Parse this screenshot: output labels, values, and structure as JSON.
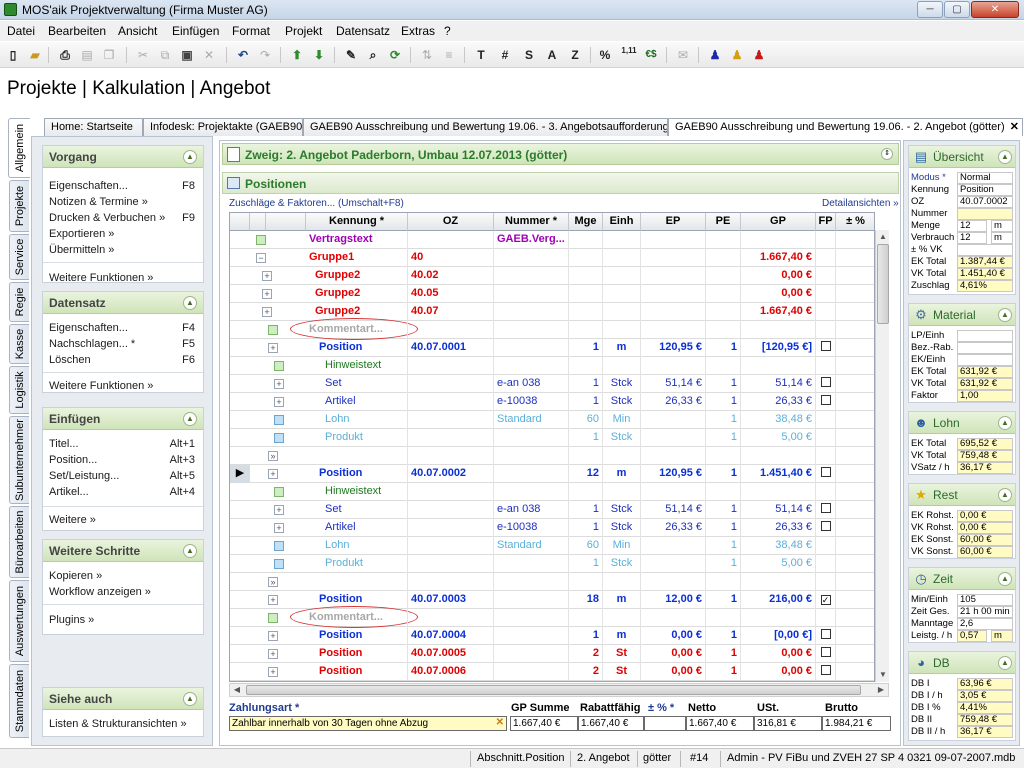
{
  "window": {
    "title": "MOS'aik Projektverwaltung (Firma Muster AG)",
    "min": "─",
    "max": "▢",
    "close": "✕"
  },
  "menu": [
    "Datei",
    "Bearbeiten",
    "Ansicht",
    "Einfügen",
    "Format",
    "Projekt",
    "Datensatz",
    "Extras",
    "?"
  ],
  "toolbar": {
    "text_buttons": [
      "T",
      "#",
      "S",
      "A",
      "Z",
      "%",
      "1,11",
      "€$"
    ]
  },
  "heading": "Projekte | Kalkulation | Angebot",
  "vtabs": [
    "Allgemein",
    "Projekte",
    "Service",
    "Regie",
    "Kasse",
    "Logistik",
    "Subunternehmer",
    "Büroarbeiten",
    "Auswertungen",
    "Stammdaten"
  ],
  "tabs": [
    "Home: Startseite",
    "Infodesk: Projektakte (GAEB90",
    "GAEB90 Ausschreibung und Bewertung 19.06. - 3. Angebotsaufforderung",
    "GAEB90 Ausschreibung und Bewertung 19.06. - 2. Angebot (götter)"
  ],
  "left": {
    "vorgang": {
      "title": "Vorgang",
      "items": [
        {
          "label": "Eigenschaften...",
          "key": "F8"
        },
        {
          "label": "Notizen & Termine »",
          "key": ""
        },
        {
          "label": "Drucken & Verbuchen »",
          "key": "F9"
        },
        {
          "label": "Exportieren »",
          "key": ""
        },
        {
          "label": "Übermitteln »",
          "key": ""
        }
      ],
      "more": "Weitere Funktionen »"
    },
    "datensatz": {
      "title": "Datensatz",
      "items": [
        {
          "label": "Eigenschaften...",
          "key": "F4"
        },
        {
          "label": "Nachschlagen... *",
          "key": "F5"
        },
        {
          "label": "Löschen",
          "key": "F6"
        }
      ],
      "more": "Weitere Funktionen »"
    },
    "einfuegen": {
      "title": "Einfügen",
      "items": [
        {
          "label": "Titel...",
          "key": "Alt+1"
        },
        {
          "label": "Position...",
          "key": "Alt+3"
        },
        {
          "label": "Set/Leistung...",
          "key": "Alt+5"
        },
        {
          "label": "Artikel...",
          "key": "Alt+4"
        }
      ],
      "more": "Weitere »"
    },
    "schritte": {
      "title": "Weitere Schritte",
      "items": [
        "Kopieren »",
        "Workflow anzeigen »"
      ],
      "more": "Plugins »"
    },
    "siehe": {
      "title": "Siehe auch",
      "items": [
        "Listen & Strukturansichten »"
      ]
    }
  },
  "main": {
    "zweig": "Zweig: 2. Angebot Paderborn, Umbau 12.07.2013 (götter)",
    "positionen": "Positionen",
    "zuschlaege": "Zuschläge & Faktoren... (Umschalt+F8)",
    "details": "Detailansichten »",
    "columns": [
      "Kennung *",
      "OZ",
      "Nummer *",
      "Mge",
      "Einh",
      "EP",
      "PE",
      "GP",
      "FP",
      "± %"
    ],
    "rows": [
      {
        "k": "Vertragstext",
        "oz": "",
        "nr": "GAEB.Verg...",
        "mge": "",
        "einh": "",
        "ep": "",
        "pe": "",
        "gp": "",
        "fp": "",
        "cls": "purple",
        "node": "g",
        "lvl": 0,
        "exp": false
      },
      {
        "k": "Gruppe1",
        "oz": "40",
        "nr": "",
        "mge": "",
        "einh": "",
        "ep": "",
        "pe": "",
        "gp": "1.667,40 €",
        "fp": "",
        "cls": "red",
        "node": "",
        "lvl": 0,
        "exp": true
      },
      {
        "k": "Gruppe2",
        "oz": "40.02",
        "nr": "",
        "mge": "",
        "einh": "",
        "ep": "",
        "pe": "",
        "gp": "0,00 €",
        "fp": "",
        "cls": "red",
        "node": "",
        "lvl": 1,
        "exp": true
      },
      {
        "k": "Gruppe2",
        "oz": "40.05",
        "nr": "",
        "mge": "",
        "einh": "",
        "ep": "",
        "pe": "",
        "gp": "0,00 €",
        "fp": "",
        "cls": "red",
        "node": "",
        "lvl": 1,
        "exp": true
      },
      {
        "k": "Gruppe2",
        "oz": "40.07",
        "nr": "",
        "mge": "",
        "einh": "",
        "ep": "",
        "pe": "",
        "gp": "1.667,40 €",
        "fp": "",
        "cls": "red",
        "node": "",
        "lvl": 1,
        "exp": true
      },
      {
        "k": "Kommentart...",
        "oz": "",
        "nr": "",
        "mge": "",
        "einh": "",
        "ep": "",
        "pe": "",
        "gp": "",
        "fp": "",
        "cls": "gray",
        "node": "g",
        "lvl": 2,
        "exp": false,
        "oval": true
      },
      {
        "k": "Position",
        "oz": "40.07.0001",
        "nr": "",
        "mge": "1",
        "einh": "m",
        "ep": "120,95 €",
        "pe": "1",
        "gp": "[120,95 €]",
        "fp": "□",
        "cls": "blue",
        "node": "",
        "lvl": 2,
        "exp": true
      },
      {
        "k": "Hinweistext",
        "oz": "",
        "nr": "",
        "mge": "",
        "einh": "",
        "ep": "",
        "pe": "",
        "gp": "",
        "fp": "",
        "cls": "green",
        "node": "g",
        "lvl": 3,
        "exp": false
      },
      {
        "k": "Set",
        "oz": "",
        "nr": "e-an 038",
        "mge": "1",
        "einh": "Stck",
        "ep": "51,14 €",
        "pe": "1",
        "gp": "51,14 €",
        "fp": "□",
        "cls": "lblue",
        "node": "",
        "lvl": 3,
        "exp": true
      },
      {
        "k": "Artikel",
        "oz": "",
        "nr": "e-10038",
        "mge": "1",
        "einh": "Stck",
        "ep": "26,33 €",
        "pe": "1",
        "gp": "26,33 €",
        "fp": "□",
        "cls": "lblue",
        "node": "",
        "lvl": 3,
        "exp": true
      },
      {
        "k": "Lohn",
        "oz": "",
        "nr": "Standard",
        "mge": "60",
        "einh": "Min",
        "ep": "",
        "pe": "1",
        "gp": "38,48 €",
        "fp": "",
        "cls": "cyan",
        "node": "b",
        "lvl": 3,
        "exp": false
      },
      {
        "k": "Produkt",
        "oz": "",
        "nr": "",
        "mge": "1",
        "einh": "Stck",
        "ep": "",
        "pe": "1",
        "gp": "5,00 €",
        "fp": "",
        "cls": "cyan",
        "node": "b",
        "lvl": 3,
        "exp": false
      },
      {
        "k": "",
        "oz": "",
        "nr": "",
        "mge": "",
        "einh": "",
        "ep": "",
        "pe": "",
        "gp": "",
        "fp": "",
        "cls": "",
        "node": "",
        "lvl": 2,
        "exp": false,
        "more": true
      },
      {
        "k": "Position",
        "oz": "40.07.0002",
        "nr": "",
        "mge": "12",
        "einh": "m",
        "ep": "120,95 €",
        "pe": "1",
        "gp": "1.451,40 €",
        "fp": "□",
        "cls": "blue",
        "node": "",
        "lvl": 2,
        "exp": true,
        "current": true
      },
      {
        "k": "Hinweistext",
        "oz": "",
        "nr": "",
        "mge": "",
        "einh": "",
        "ep": "",
        "pe": "",
        "gp": "",
        "fp": "",
        "cls": "green",
        "node": "g",
        "lvl": 3,
        "exp": false
      },
      {
        "k": "Set",
        "oz": "",
        "nr": "e-an 038",
        "mge": "1",
        "einh": "Stck",
        "ep": "51,14 €",
        "pe": "1",
        "gp": "51,14 €",
        "fp": "□",
        "cls": "lblue",
        "node": "",
        "lvl": 3,
        "exp": true
      },
      {
        "k": "Artikel",
        "oz": "",
        "nr": "e-10038",
        "mge": "1",
        "einh": "Stck",
        "ep": "26,33 €",
        "pe": "1",
        "gp": "26,33 €",
        "fp": "□",
        "cls": "lblue",
        "node": "",
        "lvl": 3,
        "exp": true
      },
      {
        "k": "Lohn",
        "oz": "",
        "nr": "Standard",
        "mge": "60",
        "einh": "Min",
        "ep": "",
        "pe": "1",
        "gp": "38,48 €",
        "fp": "",
        "cls": "cyan",
        "node": "b",
        "lvl": 3,
        "exp": false
      },
      {
        "k": "Produkt",
        "oz": "",
        "nr": "",
        "mge": "1",
        "einh": "Stck",
        "ep": "",
        "pe": "1",
        "gp": "5,00 €",
        "fp": "",
        "cls": "cyan",
        "node": "b",
        "lvl": 3,
        "exp": false
      },
      {
        "k": "",
        "oz": "",
        "nr": "",
        "mge": "",
        "einh": "",
        "ep": "",
        "pe": "",
        "gp": "",
        "fp": "",
        "cls": "",
        "node": "",
        "lvl": 2,
        "exp": false,
        "more": true
      },
      {
        "k": "Position",
        "oz": "40.07.0003",
        "nr": "",
        "mge": "18",
        "einh": "m",
        "ep": "12,00 €",
        "pe": "1",
        "gp": "216,00 €",
        "fp": "☑",
        "cls": "blue",
        "node": "",
        "lvl": 2,
        "exp": true
      },
      {
        "k": "Kommentart...",
        "oz": "",
        "nr": "",
        "mge": "",
        "einh": "",
        "ep": "",
        "pe": "",
        "gp": "",
        "fp": "",
        "cls": "gray",
        "node": "g",
        "lvl": 2,
        "exp": false,
        "oval": true
      },
      {
        "k": "Position",
        "oz": "40.07.0004",
        "nr": "",
        "mge": "1",
        "einh": "m",
        "ep": "0,00 €",
        "pe": "1",
        "gp": "[0,00 €]",
        "fp": "□",
        "cls": "blue",
        "node": "",
        "lvl": 2,
        "exp": true
      },
      {
        "k": "Position",
        "oz": "40.07.0005",
        "nr": "",
        "mge": "2",
        "einh": "St",
        "ep": "0,00 €",
        "pe": "1",
        "gp": "0,00 €",
        "fp": "□",
        "cls": "red",
        "node": "",
        "lvl": 2,
        "exp": true
      },
      {
        "k": "Position",
        "oz": "40.07.0006",
        "nr": "",
        "mge": "2",
        "einh": "St",
        "ep": "0,00 €",
        "pe": "1",
        "gp": "0,00 €",
        "fp": "□",
        "cls": "red",
        "node": "",
        "lvl": 2,
        "exp": true
      }
    ]
  },
  "footer": {
    "zahlungsart_label": "Zahlungsart *",
    "zahlungsart": "Zahlbar innerhalb von 30 Tagen ohne Abzug",
    "gp_summe_label": "GP Summe",
    "gp_summe": "1.667,40 €",
    "rabattfaehig_label": "Rabattfähig",
    "rabattfaehig": "1.667,40 €",
    "pm_label": "± % *",
    "pm": "",
    "netto_label": "Netto",
    "netto": "1.667,40 €",
    "ust_label": "USt.",
    "ust": "316,81 €",
    "brutto_label": "Brutto",
    "brutto": "1.984,21 €"
  },
  "right": {
    "uebersicht": {
      "title": "Übersicht",
      "rows": [
        [
          "Modus *",
          "Normal",
          ""
        ],
        [
          "Kennung",
          "Position",
          ""
        ],
        [
          "OZ",
          "40.07.0002",
          ""
        ],
        [
          "Nummer",
          "",
          "y"
        ],
        [
          "Menge",
          "12",
          "",
          "m"
        ],
        [
          "Verbrauch",
          "12",
          "",
          "m"
        ],
        [
          "± % VK",
          "",
          ""
        ],
        [
          "EK Total",
          "1.387,44 €",
          "y"
        ],
        [
          "VK Total",
          "1.451,40 €",
          "y"
        ],
        [
          "Zuschlag",
          "4,61%",
          "y"
        ]
      ]
    },
    "material": {
      "title": "Material",
      "rows": [
        [
          "LP/Einh",
          "",
          ""
        ],
        [
          "Bez.-Rab.",
          "",
          ""
        ],
        [
          "EK/Einh",
          "",
          ""
        ],
        [
          "EK Total",
          "631,92 €",
          "y"
        ],
        [
          "VK Total",
          "631,92 €",
          "y"
        ],
        [
          "Faktor",
          "1,00",
          "y"
        ]
      ]
    },
    "lohn": {
      "title": "Lohn",
      "rows": [
        [
          "EK Total",
          "695,52 €",
          "y"
        ],
        [
          "VK Total",
          "759,48 €",
          "y"
        ],
        [
          "VSatz / h",
          "36,17 €",
          "y"
        ]
      ]
    },
    "rest": {
      "title": "Rest",
      "rows": [
        [
          "EK Rohst.",
          "0,00 €",
          "y"
        ],
        [
          "VK Rohst.",
          "0,00 €",
          "y"
        ],
        [
          "EK Sonst.",
          "60,00 €",
          "y"
        ],
        [
          "VK Sonst.",
          "60,00 €",
          "y"
        ]
      ]
    },
    "zeit": {
      "title": "Zeit",
      "rows": [
        [
          "Min/Einh",
          "105",
          ""
        ],
        [
          "Zeit Ges.",
          "21 h 00 min",
          ""
        ],
        [
          "Manntage",
          "2,6",
          ""
        ],
        [
          "Leistg. / h",
          "0,57",
          "y",
          "m"
        ]
      ]
    },
    "db": {
      "title": "DB",
      "rows": [
        [
          "DB I",
          "63,96 €",
          "y"
        ],
        [
          "DB I / h",
          "3,05 €",
          "y"
        ],
        [
          "DB I %",
          "4,41%",
          "y"
        ],
        [
          "DB II",
          "759,48 €",
          "y"
        ],
        [
          "DB II / h",
          "36,17 €",
          "y"
        ]
      ]
    }
  },
  "status": [
    "Abschnitt.Position",
    "2. Angebot",
    "götter",
    "#14",
    "Admin - PV FiBu und ZVEH 27 SP 4 0321 09-07-2007.mdb"
  ]
}
